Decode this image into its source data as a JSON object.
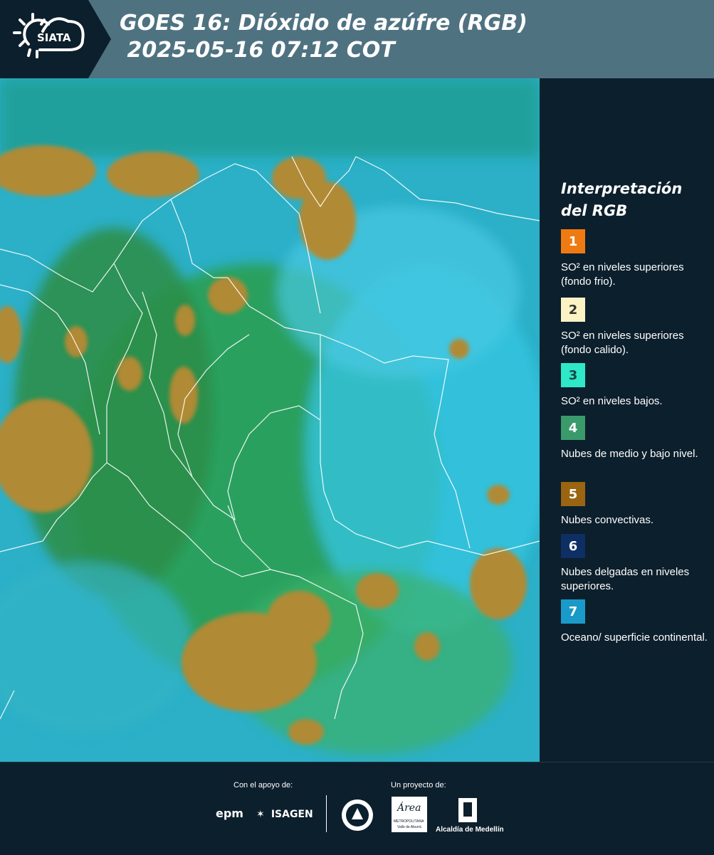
{
  "header": {
    "logo_text": "SIATA",
    "title_line1": "GOES 16: Dióxido de azúfre (RGB)",
    "title_line2": " 2025-05-16 07:12 COT",
    "colors": {
      "background": "#4f7281",
      "logo_background": "#0c1f2c"
    }
  },
  "map": {
    "description_icon": "satellite-rgb-image",
    "colors": {
      "land": "#2aa05a",
      "ocean": "#3cc0d8",
      "convective": "#a8842e",
      "borders": "#ffffff"
    }
  },
  "legend": {
    "title": "Interpretación del RGB",
    "items": [
      {
        "number": "1",
        "color": "#f07a12",
        "text": "SO² en niveles superiores (fondo frio)."
      },
      {
        "number": "2",
        "color": "#fbf3c4",
        "text": "SO² en niveles superiores (fondo calido)."
      },
      {
        "number": "3",
        "color": "#2ee8c8",
        "text": "SO² en niveles bajos."
      },
      {
        "number": "4",
        "color": "#3a9a6c",
        "text": "Nubes de medio y bajo nivel."
      },
      {
        "number": "5",
        "color": "#9a6410",
        "text": "Nubes convectivas."
      },
      {
        "number": "6",
        "color": "#0e2f64",
        "text": "Nubes delgadas en niveles superiores."
      },
      {
        "number": "7",
        "color": "#1a9ac8",
        "text": "Oceano/ superficie continental."
      }
    ]
  },
  "footer": {
    "support_label": "Con el apoyo de:",
    "project_label": "Un proyecto de:",
    "sponsors": [
      "epm",
      "ISAGEN"
    ],
    "partners": [
      "METROPOLITANA",
      "Valle de Aburrá",
      "Alcaldía de Medellín"
    ],
    "partner_logo_text": "Área"
  }
}
